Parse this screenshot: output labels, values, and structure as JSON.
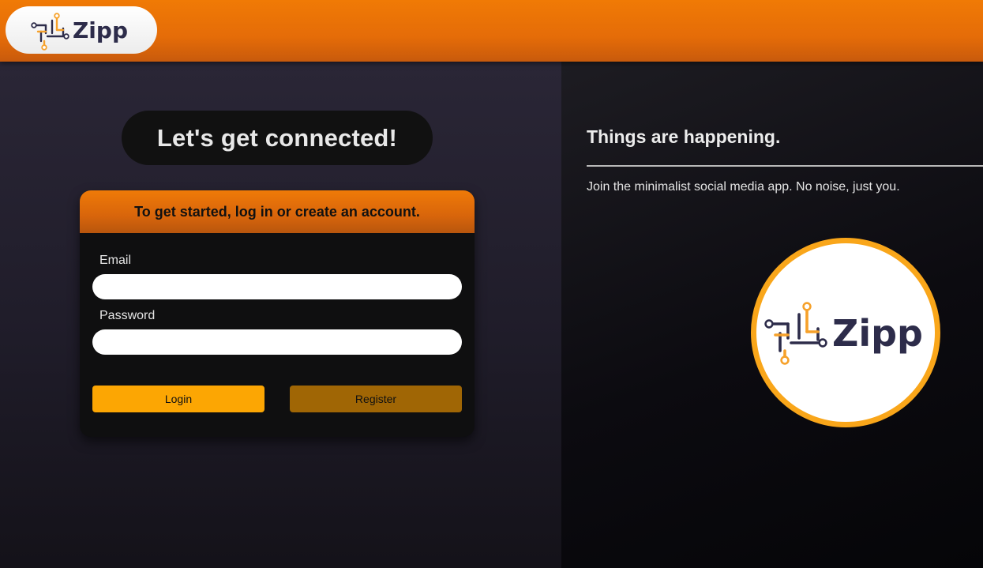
{
  "header": {
    "logo_text": "Zipp",
    "colors": {
      "bar": "#ef7a05",
      "logo_text": "#2d2c4a",
      "logo_accent": "#f6a12a"
    }
  },
  "left": {
    "headline": "Let's get connected!",
    "card": {
      "header_text": "To get started, log in or create an account.",
      "email_label": "Email",
      "email_value": "",
      "password_label": "Password",
      "password_value": "",
      "login_label": "Login",
      "register_label": "Register"
    }
  },
  "right": {
    "title": "Things are happening.",
    "subtitle": "Join the minimalist social media app. No noise, just you.",
    "logo_text": "Zipp"
  },
  "colors": {
    "login": "#fca603",
    "register": "#a06605",
    "ring": "#f9a61a"
  },
  "icons": [
    "zipp-logo-icon"
  ]
}
